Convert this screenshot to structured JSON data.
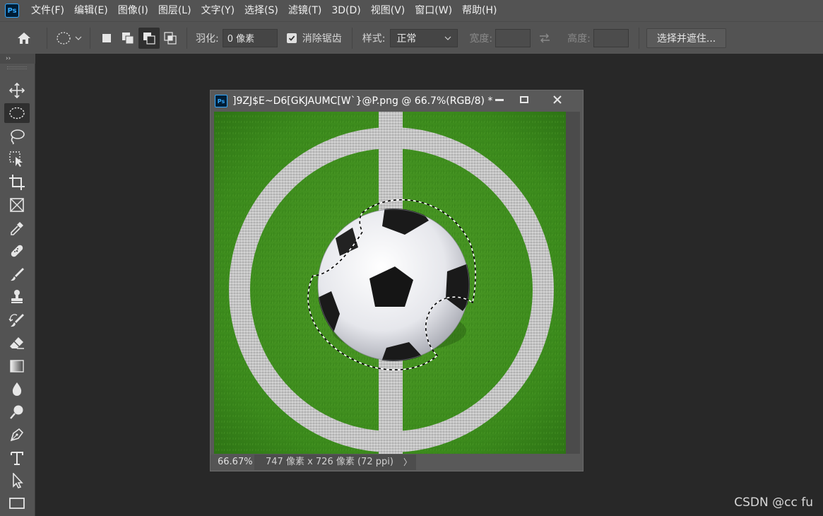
{
  "app": {
    "logo": "Ps"
  },
  "menu": [
    {
      "label": "文件(F)"
    },
    {
      "label": "编辑(E)"
    },
    {
      "label": "图像(I)"
    },
    {
      "label": "图层(L)"
    },
    {
      "label": "文字(Y)"
    },
    {
      "label": "选择(S)"
    },
    {
      "label": "滤镜(T)"
    },
    {
      "label": "3D(D)"
    },
    {
      "label": "视图(V)"
    },
    {
      "label": "窗口(W)"
    },
    {
      "label": "帮助(H)"
    }
  ],
  "options": {
    "feather_label": "羽化:",
    "feather_value": "0 像素",
    "antialias_label": "消除锯齿",
    "antialias_checked": true,
    "style_label": "样式:",
    "style_value": "正常",
    "width_label": "宽度:",
    "height_label": "高度:",
    "select_mask_label": "选择并遮住..."
  },
  "toolbar": {
    "collapse": "››",
    "tools": [
      {
        "name": "move-tool-icon"
      },
      {
        "name": "elliptical-marquee-tool-icon",
        "active": true
      },
      {
        "name": "lasso-tool-icon"
      },
      {
        "name": "object-selection-tool-icon"
      },
      {
        "name": "crop-tool-icon"
      },
      {
        "name": "frame-tool-icon"
      },
      {
        "name": "eyedropper-tool-icon"
      },
      {
        "name": "healing-brush-tool-icon"
      },
      {
        "name": "brush-tool-icon"
      },
      {
        "name": "clone-stamp-tool-icon"
      },
      {
        "name": "history-brush-tool-icon"
      },
      {
        "name": "eraser-tool-icon"
      },
      {
        "name": "gradient-tool-icon"
      },
      {
        "name": "blur-tool-icon"
      },
      {
        "name": "dodge-tool-icon"
      },
      {
        "name": "pen-tool-icon"
      },
      {
        "name": "type-tool-icon"
      },
      {
        "name": "path-selection-tool-icon"
      },
      {
        "name": "rectangle-tool-icon"
      }
    ]
  },
  "document": {
    "title": "]9ZJ$E~D6[GKJAUMC[W`}@P.png @ 66.7%(RGB/8) *",
    "zoom": "66.67%",
    "info": "747 像素 x 726 像素 (72 ppi)",
    "info_arrow": "〉"
  },
  "colors": {
    "ui_bg": "#535353",
    "workspace": "#282828",
    "grass": "#3d8a1f",
    "line": "#cfcfcf",
    "ball_white": "#f2f2f4",
    "ball_black": "#1a1a1a"
  },
  "watermark": "CSDN @cc fu"
}
